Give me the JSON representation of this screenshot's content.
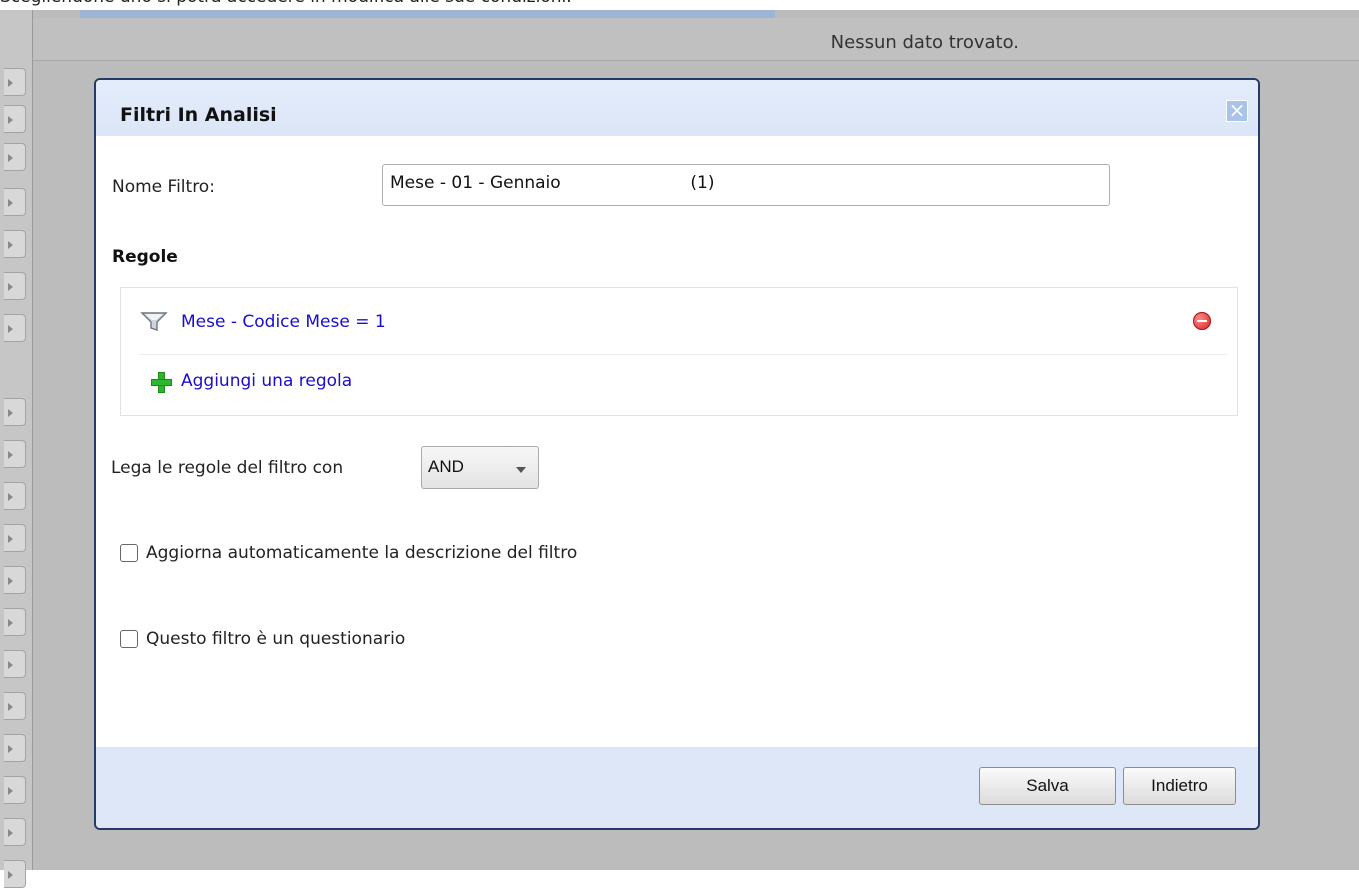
{
  "page": {
    "top_text": "Scegliendone uno si potrà accedere in modifica alle sue condizioni."
  },
  "background": {
    "no_data": "Nessun dato trovato."
  },
  "dialog": {
    "title": "Filtri In Analisi",
    "close_icon": "close-icon",
    "name_label": "Nome Filtro:",
    "name_value": "Mese - 01 - Gennaio                        (1)",
    "rules_heading": "Regole",
    "rules": [
      {
        "icon": "funnel-icon",
        "text": "Mese - Codice Mese = 1",
        "remove_icon": "remove-icon"
      }
    ],
    "add_rule": {
      "icon": "plus-icon",
      "text": "Aggiungi una regola"
    },
    "link_label": "Lega le regole del filtro con",
    "link_select": {
      "value": "AND"
    },
    "checkbox_auto_description": {
      "label": "Aggiorna automaticamente la descrizione del filtro",
      "checked": false
    },
    "checkbox_questionnaire": {
      "label": "Questo filtro è un questionario",
      "checked": false
    },
    "buttons": {
      "save": "Salva",
      "back": "Indietro"
    }
  },
  "colors": {
    "dialog_border": "#233b66",
    "header_bg": "#dbe6f8",
    "footer_bg": "#dde7f7",
    "link": "#1a0dcf",
    "overlay": "#bcbcbc"
  }
}
